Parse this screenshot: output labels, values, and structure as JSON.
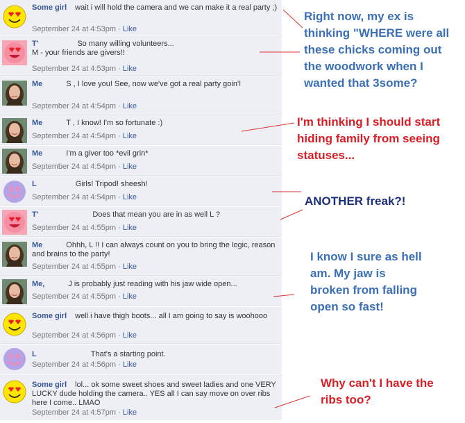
{
  "comments": [
    {
      "author": "Some girl",
      "avatar": "smiley-heart-eyes",
      "text": "wait i will hold the camera and we can make it a real party ;)",
      "time": "September 24 at 4:53pm",
      "like": "Like"
    },
    {
      "author": "T'",
      "avatar": "pink-smiley",
      "text": "So many willing volunteers...",
      "text2": "M        - your friends are givers!!",
      "time": "September 24 at 4:53pm",
      "like": "Like"
    },
    {
      "author": "Me",
      "avatar": "woman-photo",
      "text": "S       , I love you! See, now we've got a real party goin'!",
      "time": "September 24 at 4:54pm",
      "like": "Like"
    },
    {
      "author": "Me",
      "avatar": "woman-photo",
      "text": "T    , I know! I'm so fortunate :)",
      "time": "September 24 at 4:54pm",
      "like": "Like"
    },
    {
      "author": "Me",
      "avatar": "woman-photo",
      "text": "I'm a giver too *evil grin*",
      "time": "September 24 at 4:54pm",
      "like": "Like"
    },
    {
      "author": "L",
      "avatar": "purple-smiley",
      "text": "Girls! Tripod! sheesh!",
      "time": "September 24 at 4:54pm",
      "like": "Like"
    },
    {
      "author": "T'",
      "avatar": "pink-smiley",
      "text": "Does that mean you are in as well L        ?",
      "time": "September 24 at 4:55pm",
      "like": "Like"
    },
    {
      "author": "Me",
      "avatar": "woman-photo",
      "text": "Ohhh, L        !! I can always count on you to bring the logic, reason and brains to the party!",
      "time": "September 24 at 4:55pm",
      "like": "Like"
    },
    {
      "author": "Me,",
      "avatar": "woman-photo",
      "text": "J        is probably just reading with his jaw wide open...",
      "time": "September 24 at 4:55pm",
      "like": "Like"
    },
    {
      "author": "Some girl",
      "avatar": "smiley-heart-eyes",
      "text": "well i have thigh boots... all I am going to say is woohooo",
      "time": "September 24 at 4:56pm",
      "like": "Like"
    },
    {
      "author": "L",
      "avatar": "purple-smiley",
      "text": "That's a starting point.",
      "time": "September 24 at 4:56pm",
      "like": "Like"
    },
    {
      "author": "Some girl",
      "avatar": "smiley-heart-eyes",
      "text": "lol... ok some sweet shoes and sweet ladies and one VERY LUCKY dude holding the camera.. YES all I can say move on over ribs here I come.. LMAO",
      "time": "September 24 at 4:57pm",
      "like": "Like"
    }
  ],
  "annotations": [
    {
      "text": "Right now, my ex is thinking \"WHERE were all these chicks coming out the woodwork when I wanted that 3some?",
      "color": "#3b6fb6"
    },
    {
      "text": "I'm thinking I should start hiding family from seeing statuses...",
      "color": "#d81f26"
    },
    {
      "text": "ANOTHER freak?!",
      "color": "#1c2f7a"
    },
    {
      "text": "I know I sure as hell am. My jaw is broken from falling open so fast!",
      "color": "#3b6fb6"
    },
    {
      "text": "Why can't I have the ribs too?",
      "color": "#d81f26"
    }
  ],
  "separator": " · "
}
